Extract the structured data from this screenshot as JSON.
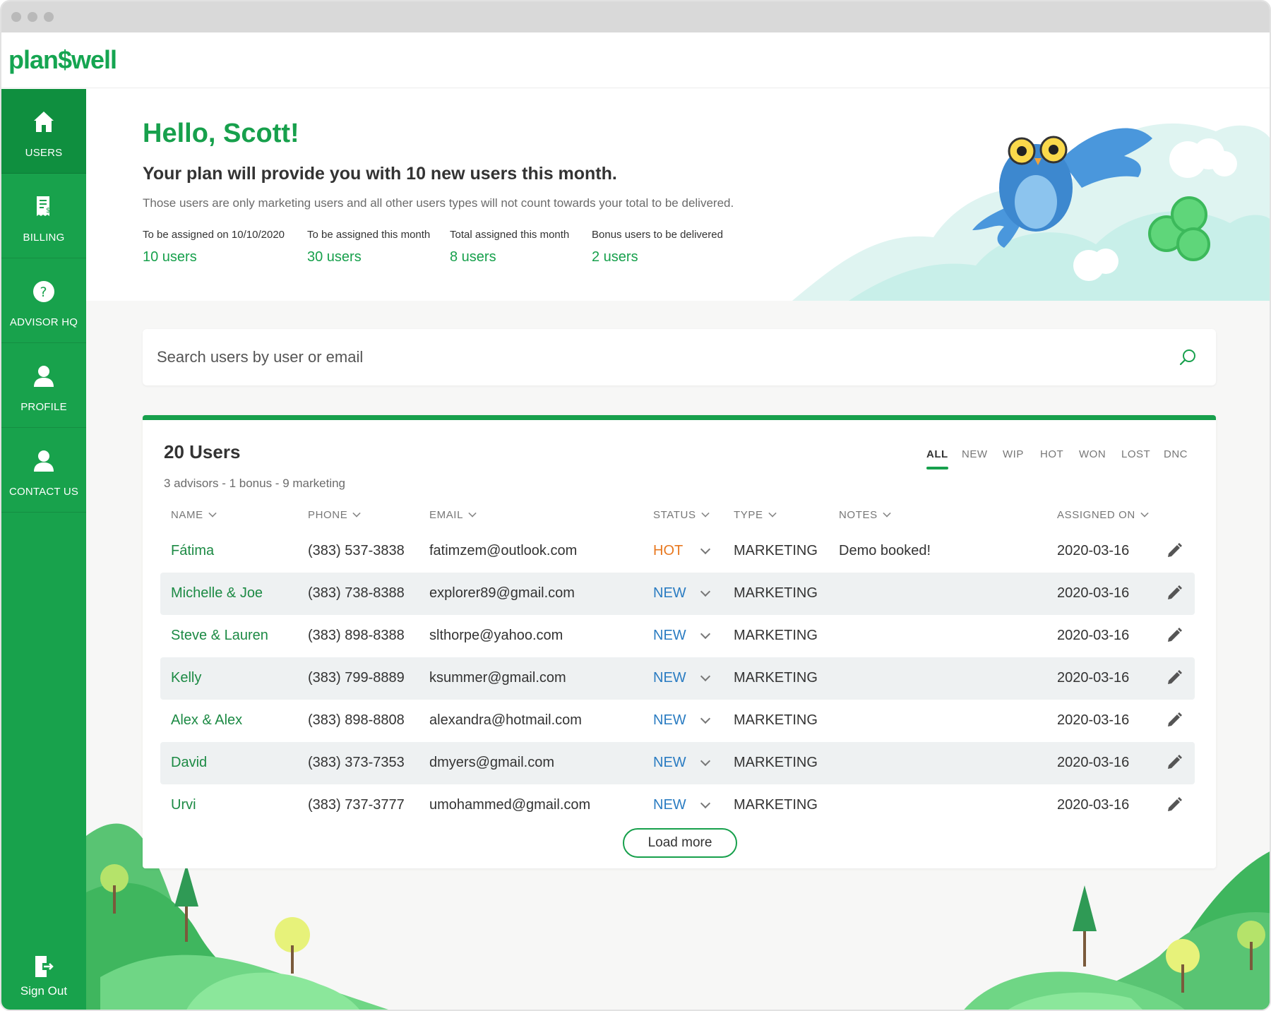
{
  "app": {
    "logo": "plan$well"
  },
  "sidebar": {
    "items": [
      {
        "label": "USERS",
        "icon": "home-icon",
        "active": true
      },
      {
        "label": "BILLING",
        "icon": "receipt-icon",
        "active": false
      },
      {
        "label": "ADVISOR HQ",
        "icon": "help-icon",
        "active": false
      },
      {
        "label": "PROFILE",
        "icon": "person-icon",
        "active": false
      },
      {
        "label": "CONTACT US",
        "icon": "person-icon",
        "active": false
      }
    ],
    "signout": {
      "label": "Sign Out",
      "icon": "sign-out-icon"
    }
  },
  "hero": {
    "greeting": "Hello, Scott!",
    "plan_line": "Your plan will provide you with 10 new users this month.",
    "plan_sub": "Those users are only marketing users and all other users types will not count towards your total to be delivered.",
    "stats": [
      {
        "label": "To be assigned on 10/10/2020",
        "value": "10 users"
      },
      {
        "label": "To be assigned this month",
        "value": "30 users"
      },
      {
        "label": "Total assigned this month",
        "value": "8 users"
      },
      {
        "label": "Bonus users to be delivered",
        "value": "2 users"
      }
    ]
  },
  "search": {
    "placeholder": "Search users by user or email",
    "value": ""
  },
  "users_panel": {
    "title": "20 Users",
    "subtitle": "3 advisors  - 1 bonus - 9 marketing",
    "filters": [
      "ALL",
      "NEW",
      "WIP",
      "HOT",
      "WON",
      "LOST",
      "DNC"
    ],
    "active_filter": "ALL",
    "columns": [
      "NAME",
      "PHONE",
      "EMAIL",
      "STATUS",
      "TYPE",
      "NOTES",
      "ASSIGNED ON"
    ],
    "rows": [
      {
        "name": "Fátima",
        "phone": "(383) 537-3838",
        "email": "fatimzem@outlook.com",
        "status": "HOT",
        "type": "MARKETING",
        "notes": "Demo booked!",
        "assigned": "2020-03-16"
      },
      {
        "name": "Michelle & Joe",
        "phone": "(383) 738-8388",
        "email": "explorer89@gmail.com",
        "status": "NEW",
        "type": "MARKETING",
        "notes": "",
        "assigned": "2020-03-16"
      },
      {
        "name": "Steve & Lauren",
        "phone": "(383) 898-8388",
        "email": "slthorpe@yahoo.com",
        "status": "NEW",
        "type": "MARKETING",
        "notes": "",
        "assigned": "2020-03-16"
      },
      {
        "name": "Kelly",
        "phone": "(383) 799-8889",
        "email": "ksummer@gmail.com",
        "status": "NEW",
        "type": "MARKETING",
        "notes": "",
        "assigned": "2020-03-16"
      },
      {
        "name": "Alex & Alex",
        "phone": "(383) 898-8808",
        "email": "alexandra@hotmail.com",
        "status": "NEW",
        "type": "MARKETING",
        "notes": "",
        "assigned": "2020-03-16"
      },
      {
        "name": "David",
        "phone": "(383) 373-7353",
        "email": "dmyers@gmail.com",
        "status": "NEW",
        "type": "MARKETING",
        "notes": "",
        "assigned": "2020-03-16"
      },
      {
        "name": "Urvi",
        "phone": "(383) 737-3777",
        "email": "umohammed@gmail.com",
        "status": "NEW",
        "type": "MARKETING",
        "notes": "",
        "assigned": "2020-03-16"
      }
    ],
    "load_more_label": "Load more"
  },
  "colors": {
    "brand_green": "#17a04c",
    "sidebar_green": "#18a24c",
    "status_hot": "#e8781f",
    "status_new": "#2a7cc2"
  }
}
